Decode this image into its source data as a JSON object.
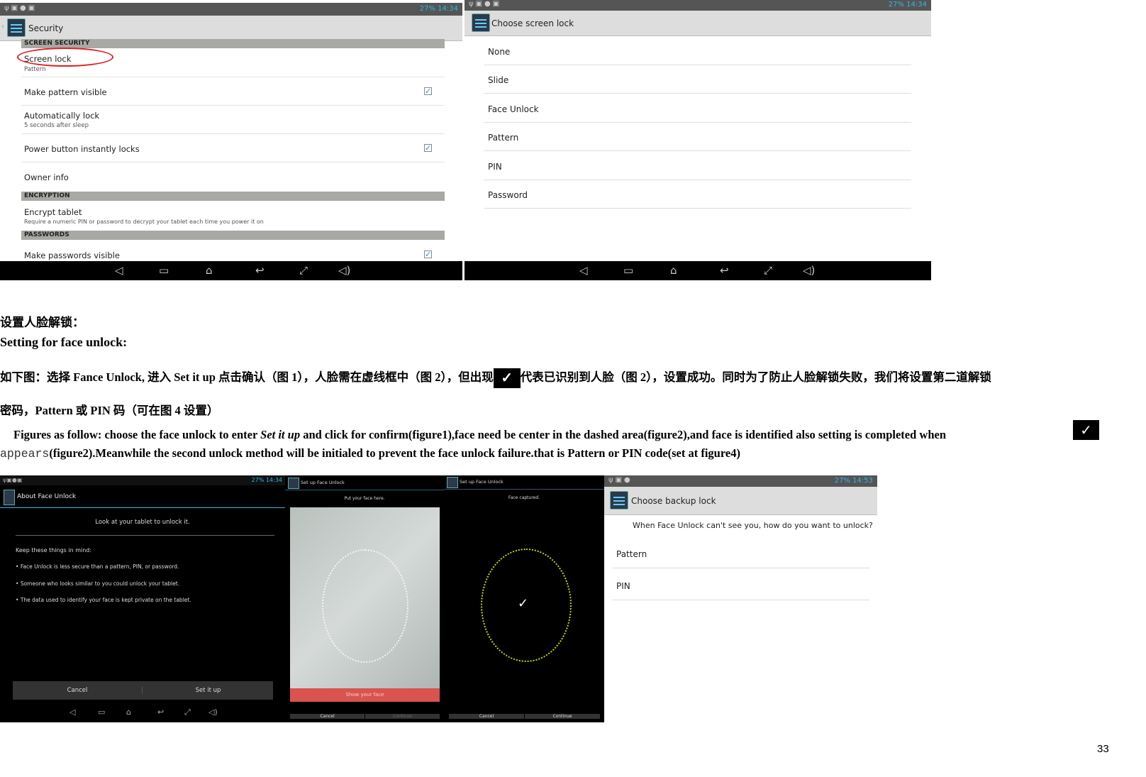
{
  "status": {
    "battery": "27%",
    "time": "14:34",
    "time2": "14:53"
  },
  "security": {
    "title": "Security",
    "sections": {
      "screen": "SCREEN SECURITY",
      "encryption": "ENCRYPTION",
      "passwords": "PASSWORDS"
    },
    "items": [
      {
        "title": "Screen lock",
        "subtitle": "Pattern"
      },
      {
        "title": "Make pattern visible",
        "checked": true
      },
      {
        "title": "Automatically lock",
        "subtitle": "5 seconds after sleep"
      },
      {
        "title": "Power button instantly locks",
        "checked": true
      },
      {
        "title": "Owner info"
      },
      {
        "title": "Encrypt tablet",
        "subtitle": "Require a numeric PIN or password to decrypt your tablet each time you power it on"
      },
      {
        "title": "Make passwords visible",
        "checked": true
      }
    ],
    "highlight_color": "#e02020"
  },
  "choose_lock": {
    "title": "Choose screen lock",
    "options": [
      "None",
      "Slide",
      "Face Unlock",
      "Pattern",
      "PIN",
      "Password"
    ]
  },
  "nav_icons": [
    "volume-down-icon",
    "recent-apps-icon",
    "home-icon",
    "back-icon",
    "fullscreen-icon",
    "volume-up-icon"
  ],
  "doc": {
    "heading_cn": "设置人脸解锁：",
    "heading_en": "Setting for face unlock:",
    "para_cn_1a": "如下图：选择 Fance Unlock, 进入 Set it up 点击确认（图 1），人脸需在虚线框中（图 2），但出现",
    "para_cn_1b": "代表已识别到人脸（图 2），设置成功。同时为了防止人脸解锁失败，我们将设置第二道解锁",
    "para_cn_2": "密码，Pattern  或 PIN 码（可在图 4 设置）",
    "para_en_1a": "Figures as follow: choose the face unlock to enter ",
    "para_en_1b": "Set it up",
    "para_en_1c": "  and click for confirm(figure1),face need be center in the dashed area(figure2),and face is identified also setting is completed when",
    "para_en_2a": "appears",
    "para_en_2b": "(figure2).Meanwhile the second unlock method will be initialed to prevent the   face unlock failure.that is   Pattern or PIN code(set at figure4)",
    "page_number": "33"
  },
  "about_face": {
    "title": "About Face Unlock",
    "headline": "Look at your tablet to unlock it.",
    "keep": "Keep these things in mind:",
    "bullets": [
      "Face Unlock is less secure than a pattern, PIN, or password.",
      "Someone who looks similar to you could unlock your tablet.",
      "The data used to identify your face is kept private on the tablet."
    ],
    "cancel": "Cancel",
    "setup": "Set it up"
  },
  "setup1": {
    "title": "Set up Face Unlock",
    "hint": "Put your face here.",
    "banner": "Show your face",
    "cancel": "Cancel",
    "continue": "Continue",
    "banner_color": "#d9534f"
  },
  "setup2": {
    "title": "Set up Face Unlock",
    "hint": "Face captured.",
    "cancel": "Cancel",
    "continue": "Continue",
    "dot_color": "#c8d400"
  },
  "backup": {
    "title": "Choose backup lock",
    "question": "When Face Unlock can't see you, how do you want to unlock?",
    "options": [
      "Pattern",
      "PIN"
    ]
  }
}
